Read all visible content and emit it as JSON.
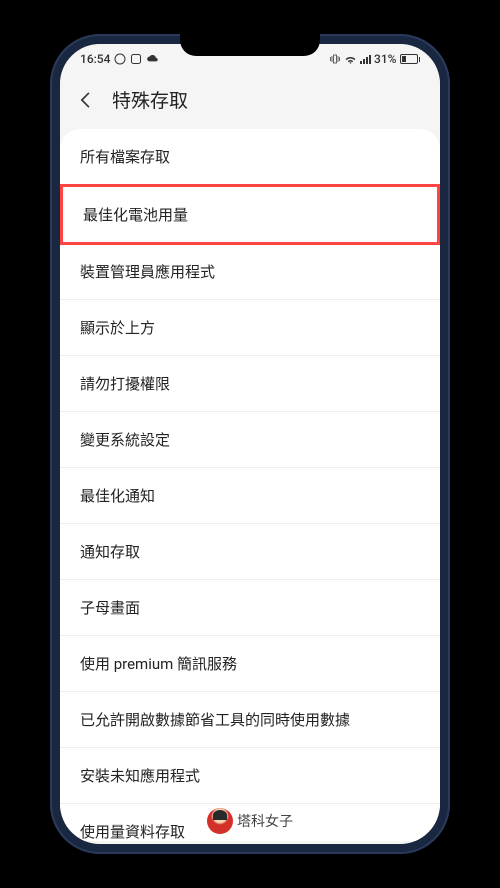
{
  "status": {
    "time": "16:54",
    "battery_percent": "31%"
  },
  "header": {
    "title": "特殊存取"
  },
  "items": [
    {
      "label": "所有檔案存取",
      "highlighted": false
    },
    {
      "label": "最佳化電池用量",
      "highlighted": true
    },
    {
      "label": "裝置管理員應用程式",
      "highlighted": false
    },
    {
      "label": "顯示於上方",
      "highlighted": false
    },
    {
      "label": "請勿打擾權限",
      "highlighted": false
    },
    {
      "label": "變更系統設定",
      "highlighted": false
    },
    {
      "label": "最佳化通知",
      "highlighted": false
    },
    {
      "label": "通知存取",
      "highlighted": false
    },
    {
      "label": "子母畫面",
      "highlighted": false
    },
    {
      "label": "使用 premium 簡訊服務",
      "highlighted": false
    },
    {
      "label": "已允許開啟數據節省工具的同時使用數據",
      "highlighted": false
    },
    {
      "label": "安裝未知應用程式",
      "highlighted": false
    },
    {
      "label": "使用量資料存取",
      "highlighted": false
    }
  ],
  "watermark": {
    "text": "塔科女子"
  }
}
